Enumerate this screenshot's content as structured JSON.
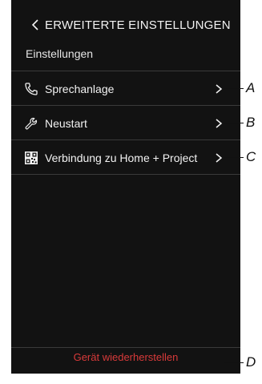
{
  "header": {
    "title": "ERWEITERTE EINSTELLUNGEN"
  },
  "section": {
    "title": "Einstellungen"
  },
  "menu": [
    {
      "label": "Sprechanlage",
      "icon": "phone-icon"
    },
    {
      "label": "Neustart",
      "icon": "wrench-icon"
    },
    {
      "label": "Verbindung zu Home + Project",
      "icon": "qr-code-icon"
    }
  ],
  "footer": {
    "restore_label": "Gerät wiederherstellen"
  },
  "callouts": {
    "a": "A",
    "b": "B",
    "c": "C",
    "d": "D"
  },
  "colors": {
    "background": "#121212",
    "text": "#f2f2f2",
    "danger": "#d83a3a"
  }
}
